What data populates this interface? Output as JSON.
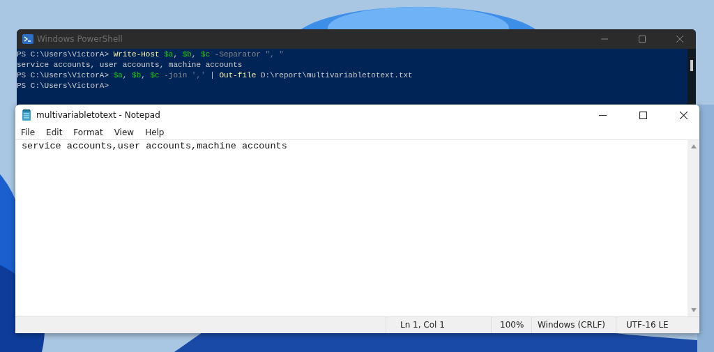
{
  "powershell": {
    "title": "Windows PowerShell",
    "lines": [
      {
        "segments": [
          {
            "text": "PS C:\\Users\\VictorA> ",
            "kind": "plain"
          },
          {
            "text": "Write-Host",
            "kind": "command"
          },
          {
            "text": " $a",
            "kind": "variable"
          },
          {
            "text": ", ",
            "kind": "plain"
          },
          {
            "text": "$b",
            "kind": "variable"
          },
          {
            "text": ", ",
            "kind": "plain"
          },
          {
            "text": "$c",
            "kind": "variable"
          },
          {
            "text": " -Separator",
            "kind": "param"
          },
          {
            "text": " \", \"",
            "kind": "string"
          }
        ]
      },
      {
        "segments": [
          {
            "text": "service accounts, user accounts, machine accounts",
            "kind": "plain"
          }
        ]
      },
      {
        "segments": [
          {
            "text": "PS C:\\Users\\VictorA> ",
            "kind": "plain"
          },
          {
            "text": "$a",
            "kind": "variable"
          },
          {
            "text": ", ",
            "kind": "plain"
          },
          {
            "text": "$b",
            "kind": "variable"
          },
          {
            "text": ", ",
            "kind": "plain"
          },
          {
            "text": "$c",
            "kind": "variable"
          },
          {
            "text": " -join",
            "kind": "param"
          },
          {
            "text": " ','",
            "kind": "string"
          },
          {
            "text": " | ",
            "kind": "plain"
          },
          {
            "text": "Out-file",
            "kind": "command"
          },
          {
            "text": " D:\\report\\multivariabletotext.txt",
            "kind": "plain"
          }
        ]
      },
      {
        "segments": [
          {
            "text": "PS C:\\Users\\VictorA>",
            "kind": "plain"
          }
        ]
      }
    ]
  },
  "notepad": {
    "title": "multivariabletotext - Notepad",
    "menu": [
      "File",
      "Edit",
      "Format",
      "View",
      "Help"
    ],
    "text": "service accounts,user accounts,machine accounts",
    "status": [
      "Ln 1, Col 1",
      "100%",
      "Windows (CRLF)",
      "UTF-16 LE"
    ]
  }
}
